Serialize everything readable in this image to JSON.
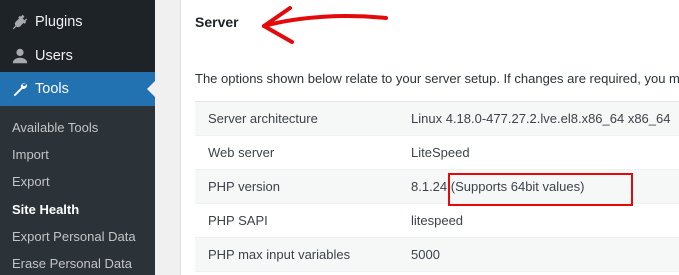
{
  "sidebar": {
    "menu": [
      {
        "label": "Plugins",
        "icon": "plug-icon"
      },
      {
        "label": "Users",
        "icon": "user-icon"
      },
      {
        "label": "Tools",
        "icon": "wrench-icon",
        "active": true
      }
    ],
    "submenu": [
      {
        "label": "Available Tools"
      },
      {
        "label": "Import"
      },
      {
        "label": "Export"
      },
      {
        "label": "Site Health",
        "current": true
      },
      {
        "label": "Export Personal Data"
      },
      {
        "label": "Erase Personal Data"
      }
    ]
  },
  "section": {
    "title": "Server",
    "description": "The options shown below relate to your server setup. If changes are required, you may"
  },
  "table": {
    "rows": [
      {
        "label": "Server architecture",
        "value": "Linux 4.18.0-477.27.2.lve.el8.x86_64 x86_64"
      },
      {
        "label": "Web server",
        "value": "LiteSpeed"
      },
      {
        "label": "PHP version",
        "value": "8.1.24 (Supports 64bit values)"
      },
      {
        "label": "PHP SAPI",
        "value": "litespeed"
      },
      {
        "label": "PHP max input variables",
        "value": "5000"
      }
    ]
  },
  "colors": {
    "sidebar_bg": "#1d2327",
    "active_bg": "#2271b1",
    "annotation_red": "#e20a0a"
  }
}
